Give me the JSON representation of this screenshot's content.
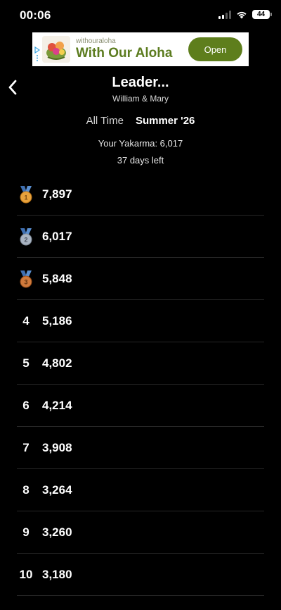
{
  "status_bar": {
    "time": "00:06",
    "battery": "44"
  },
  "ad": {
    "brand": "withouraloha",
    "title": "With Our Aloha",
    "cta": "Open"
  },
  "header": {
    "title": "Leader...",
    "subtitle": "William & Mary"
  },
  "tabs": [
    {
      "label": "All Time",
      "active": false
    },
    {
      "label": "Summer '26",
      "active": true
    }
  ],
  "yakarma_text": "Your Yakarma: 6,017",
  "days_left_text": "37 days left",
  "medal_colors": {
    "gold": "#e8a23c",
    "silver": "#a9b4c2",
    "bronze": "#d07a3c",
    "ribbon": "#3f6fb0"
  },
  "leaderboard": [
    {
      "rank": "1",
      "score": "7,897",
      "medal": "gold-medal-icon"
    },
    {
      "rank": "2",
      "score": "6,017",
      "medal": "silver-medal-icon"
    },
    {
      "rank": "3",
      "score": "5,848",
      "medal": "bronze-medal-icon"
    },
    {
      "rank": "4",
      "score": "5,186"
    },
    {
      "rank": "5",
      "score": "4,802"
    },
    {
      "rank": "6",
      "score": "4,214"
    },
    {
      "rank": "7",
      "score": "3,908"
    },
    {
      "rank": "8",
      "score": "3,264"
    },
    {
      "rank": "9",
      "score": "3,260"
    },
    {
      "rank": "10",
      "score": "3,180"
    }
  ]
}
